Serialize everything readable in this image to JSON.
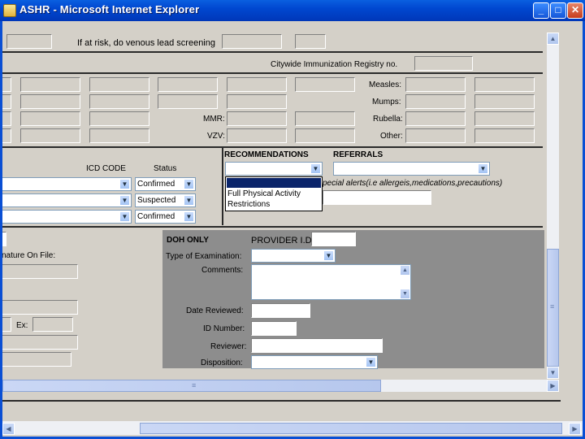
{
  "window": {
    "title": "ASHR - Microsoft Internet Explorer",
    "minimize": "_",
    "maximize": "□",
    "close": "✕"
  },
  "top": {
    "risk_label": "If at risk, do venous lead screening",
    "registry_label": "Citywide Immunization Registry no."
  },
  "immunization": {
    "measles": "Measles:",
    "mumps": "Mumps:",
    "rubella": "Rubella:",
    "other": "Other:",
    "mmr": "MMR:",
    "vzv": "VZV:"
  },
  "diagnosis": {
    "icd_header": "ICD CODE",
    "status_header": "Status",
    "rows": [
      {
        "status": "Confirmed"
      },
      {
        "status": "Suspected"
      },
      {
        "status": "Confirmed"
      }
    ]
  },
  "recommendations": {
    "header": "RECOMMENDATIONS",
    "referrals_header": "REFERRALS",
    "special_alerts": "pecial alerts(i.e allergeis,medications,precautions)",
    "options": [
      "",
      "Full Physical Activity",
      "Restrictions"
    ]
  },
  "left_bottom": {
    "signature_label": "nature On File:",
    "ext_label": "Ex:"
  },
  "doh": {
    "title": "DOH ONLY",
    "provider_label": "PROVIDER I.D.",
    "exam_label": "Type of Examination:",
    "comments_label": "Comments:",
    "date_reviewed_label": "Date Reviewed:",
    "id_number_label": "ID Number:",
    "reviewer_label": "Reviewer:",
    "disposition_label": "Disposition:"
  },
  "scroll": {
    "up": "▲",
    "down": "▼",
    "left": "◀",
    "right": "▶",
    "grip": "≡",
    "select_arrow": "▼"
  },
  "colors": {
    "titlebar": "#0047d0",
    "panel": "#d4d0c8",
    "doh_panel": "#8d8d8d",
    "highlight": "#0a246a"
  }
}
